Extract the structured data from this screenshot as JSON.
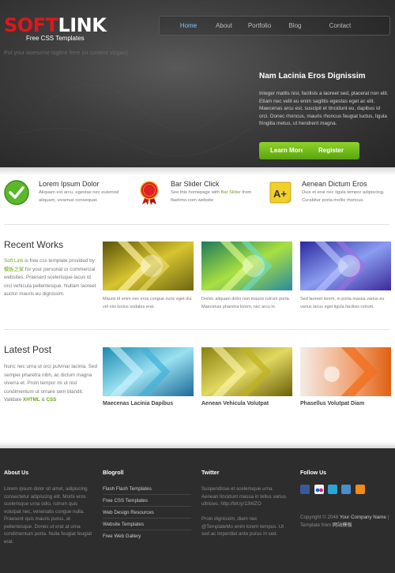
{
  "logo": {
    "soft": "SOFT",
    "link": "LINK",
    "subtitle": "Free CSS Templates"
  },
  "nav": [
    "Home",
    "About",
    "Portfolio",
    "Blog",
    "Contact"
  ],
  "tagline": "Put your awesome tagline here (or content slogan)",
  "hero": {
    "title": "Nam Lacinia Eros Dignissim",
    "text": "Integer mattis nisl, facilisis a laoreet sed, placerat non elit. Etiam nec velit eu enim sagittis egestas eget ac elit. Maecenas arcu est, suscipit et tincidunt eu, dapibus id orci. Donec rhoncus, mauris rhoncus feugiat luctus, ligula fringilla metus, ut hendrerit magna.",
    "learn_more": "Learn More",
    "register": "Register"
  },
  "features": [
    {
      "title": "Lorem Ipsum Dolor",
      "text": "Aliquam est arcu, egestas nec euismod aliquam, vivamus consequat."
    },
    {
      "title": "Bar Slider Click",
      "text_a": "See this homepage with ",
      "link": "Bar Slider",
      "text_b": " from flashmo.com website"
    },
    {
      "title": "Aenean Dictum Eros",
      "text": "Duis et erat nec ligula tempor adipiscing. Curabitur porta mollis rhoncus."
    }
  ],
  "works": {
    "title": "Recent Works",
    "intro_link": "Soft Link",
    "intro_a": " is free css template provided by ",
    "intro_site": "模板之家",
    "intro_b": " for your personal or commercial websites. Praesent scelerisque lacus id orci vehicula pellentesque. Nullam laoreet auctor mauris eu dignissim.",
    "captions": [
      "Mauris id enim nec eros congue nunc eget dui vel nisi luctus sodales erat.",
      "Donec aliquam dolor non mauris rutrum porta. Maecenas pharetra lorem, nec arcu in.",
      "Sed laoreet lorem, in porta massa varius eu varius lacus eget ligula facilisis rutrum."
    ]
  },
  "posts": {
    "title": "Latest Post",
    "intro": "Nunc nec urna ut orci pulvinar lacinia. Sed semper pharetra nibh, ac dictum magna viverra et. Proin tempor mi ut nisl condimentum ut ornare sem blandit. Validate ",
    "xhtml": "XHTML",
    "amp": " & ",
    "css": "CSS",
    "titles": [
      "Maecenas Lacinia Dapibus",
      "Aenean Vehicula Volutpat",
      "Phasellus Volutpat Diam"
    ]
  },
  "footer": {
    "about_title": "About Us",
    "about_text": "Lorem ipsum dolor sit amet, adipiscing consectetur adipiscing elit. Morbi eros scelerisque urna odio, rutrum quis volutpat nec, venenatis congue nulla. Praesent quis mauris purus, at pellentesque. Donec ut erat at urna condimentum porta. Nulla feugiat feugiat erat.",
    "blogroll_title": "Blogroll",
    "blogroll": [
      "Flash Flash Templates",
      "Free CSS Templates",
      "Web Design Resources",
      "Website Templates",
      "Free Web Gallery"
    ],
    "twitter_title": "Twitter",
    "tweet1": "Suspendisse et scelerisque urna. Aenean tincidunt massa in tellus varius ultricies. http://bit.ly/13WZO",
    "tweet2": "Proin dignissim, diam nec @TemplateMo enim lorem tempus. Ut sed ac imperdiet ante purus in sed.",
    "follow_title": "Follow Us",
    "copyright": "Copyright © 2048 ",
    "company": "Your Company Name",
    "template_from": " | Template from ",
    "template_site": "网站模板"
  }
}
